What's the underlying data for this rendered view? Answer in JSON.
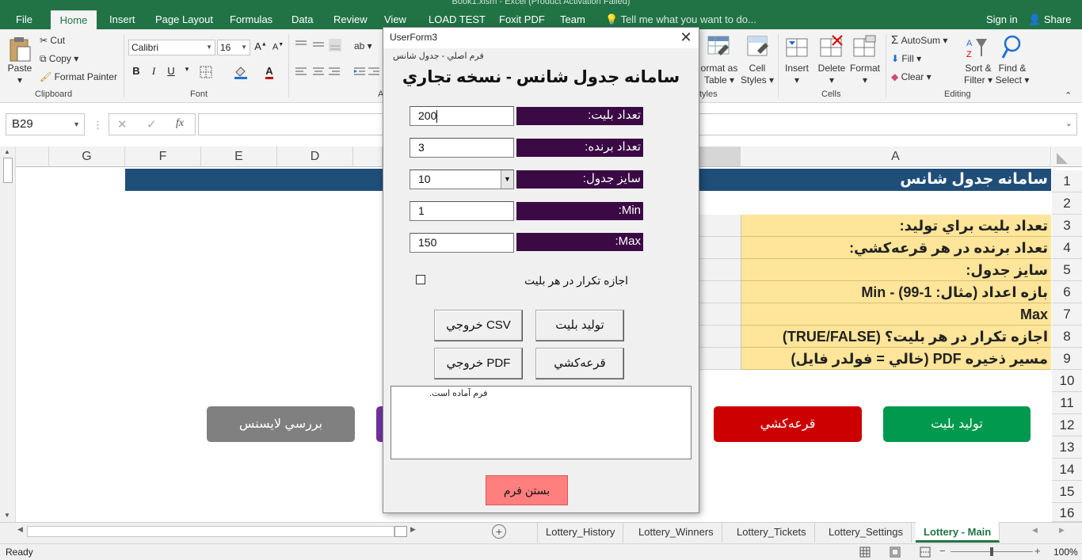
{
  "window": {
    "title": "Book1.xlsm - Excel (Product Activation Failed)",
    "ribbon_tabs": [
      "File",
      "Home",
      "Insert",
      "Page Layout",
      "Formulas",
      "Data",
      "Review",
      "View",
      "LOAD TEST",
      "Foxit PDF",
      "Team"
    ],
    "active_tab": "Home",
    "tell_me": "Tell me what you want to do...",
    "sign_in": "Sign in",
    "share": "Share"
  },
  "ribbon": {
    "clipboard": {
      "paste": "Paste",
      "cut": "Cut",
      "copy": "Copy",
      "format_painter": "Format Painter",
      "label": "Clipboard"
    },
    "font": {
      "name": "Calibri",
      "size": "16",
      "label": "Font",
      "grow": "A",
      "shrink": "A",
      "bold": "B",
      "italic": "I",
      "underline": "U"
    },
    "alignment_label": "A",
    "styles": {
      "format_as_table_1": "ormat as",
      "format_as_table_2": "Table",
      "cell_styles_1": "Cell",
      "cell_styles_2": "Styles",
      "label": "tyles"
    },
    "cells": {
      "insert": "Insert",
      "delete": "Delete",
      "format": "Format",
      "label": "Cells"
    },
    "editing": {
      "autosum": "AutoSum",
      "fill": "Fill",
      "clear": "Clear",
      "sort_filter_1": "Sort &",
      "sort_filter_2": "Filter",
      "find_select_1": "Find &",
      "find_select_2": "Select",
      "label": "Editing"
    }
  },
  "formula_bar": {
    "name_box": "B29",
    "fx": "fx",
    "value": ""
  },
  "columns": [
    "G",
    "F",
    "E",
    "D",
    "A"
  ],
  "rows": [
    "1",
    "2",
    "3",
    "4",
    "5",
    "6",
    "7",
    "8",
    "9",
    "10",
    "11",
    "12",
    "13",
    "14",
    "15",
    "16"
  ],
  "sheet": {
    "title": "سامانه جدول شانس",
    "settings_rows": [
      "تعداد بليت براي توليد:",
      "تعداد برنده در هر قرعه‌کشي:",
      "سايز جدول:",
      "بازه اعداد (مثال: 1-99) - Min",
      "Max",
      "اجازه تکرار در هر بليت؟ (TRUE/FALSE)",
      "مسير ذخيره PDF (خالي = فولدر فايل)"
    ],
    "buttons": {
      "generate": "توليد بليت",
      "draw": "قرعه‌کشي",
      "license": "بررسي لايسنس"
    },
    "colors": {
      "title_bg": "#1f4e78",
      "settings_bg": "#ffe599",
      "generate": "#00994d",
      "draw": "#cc0000",
      "license": "#808080",
      "purple": "#7030a0"
    }
  },
  "sheet_tabs": [
    "Lottery_History",
    "Lottery_Winners",
    "Lottery_Tickets",
    "Lottery_Settings",
    "Lottery - Main"
  ],
  "active_sheet": "Lottery - Main",
  "status": {
    "ready": "Ready",
    "zoom": "100%"
  },
  "dialog": {
    "title": "UserForm3",
    "subtitle": "فرم اصلي - جدول شانس",
    "heading": "سامانه جدول شانس - نسخه تجاري",
    "fields": {
      "tickets_label": "تعداد بليت:",
      "tickets_value": "200",
      "winners_label": "تعداد برنده:",
      "winners_value": "3",
      "size_label": "سايز جدول:",
      "size_value": "10",
      "min_label": "Min:",
      "min_value": "1",
      "max_label": "Max:",
      "max_value": "150"
    },
    "allow_repeat_label": "اجازه تکرار در هر بليت",
    "allow_repeat_checked": false,
    "buttons": {
      "generate": "توليد بليت",
      "csv": "خروجي CSV",
      "draw": "قرعه‌کشي",
      "pdf": "خروجي PDF",
      "close": "بستن فرم"
    },
    "log": "فرم آماده است."
  }
}
